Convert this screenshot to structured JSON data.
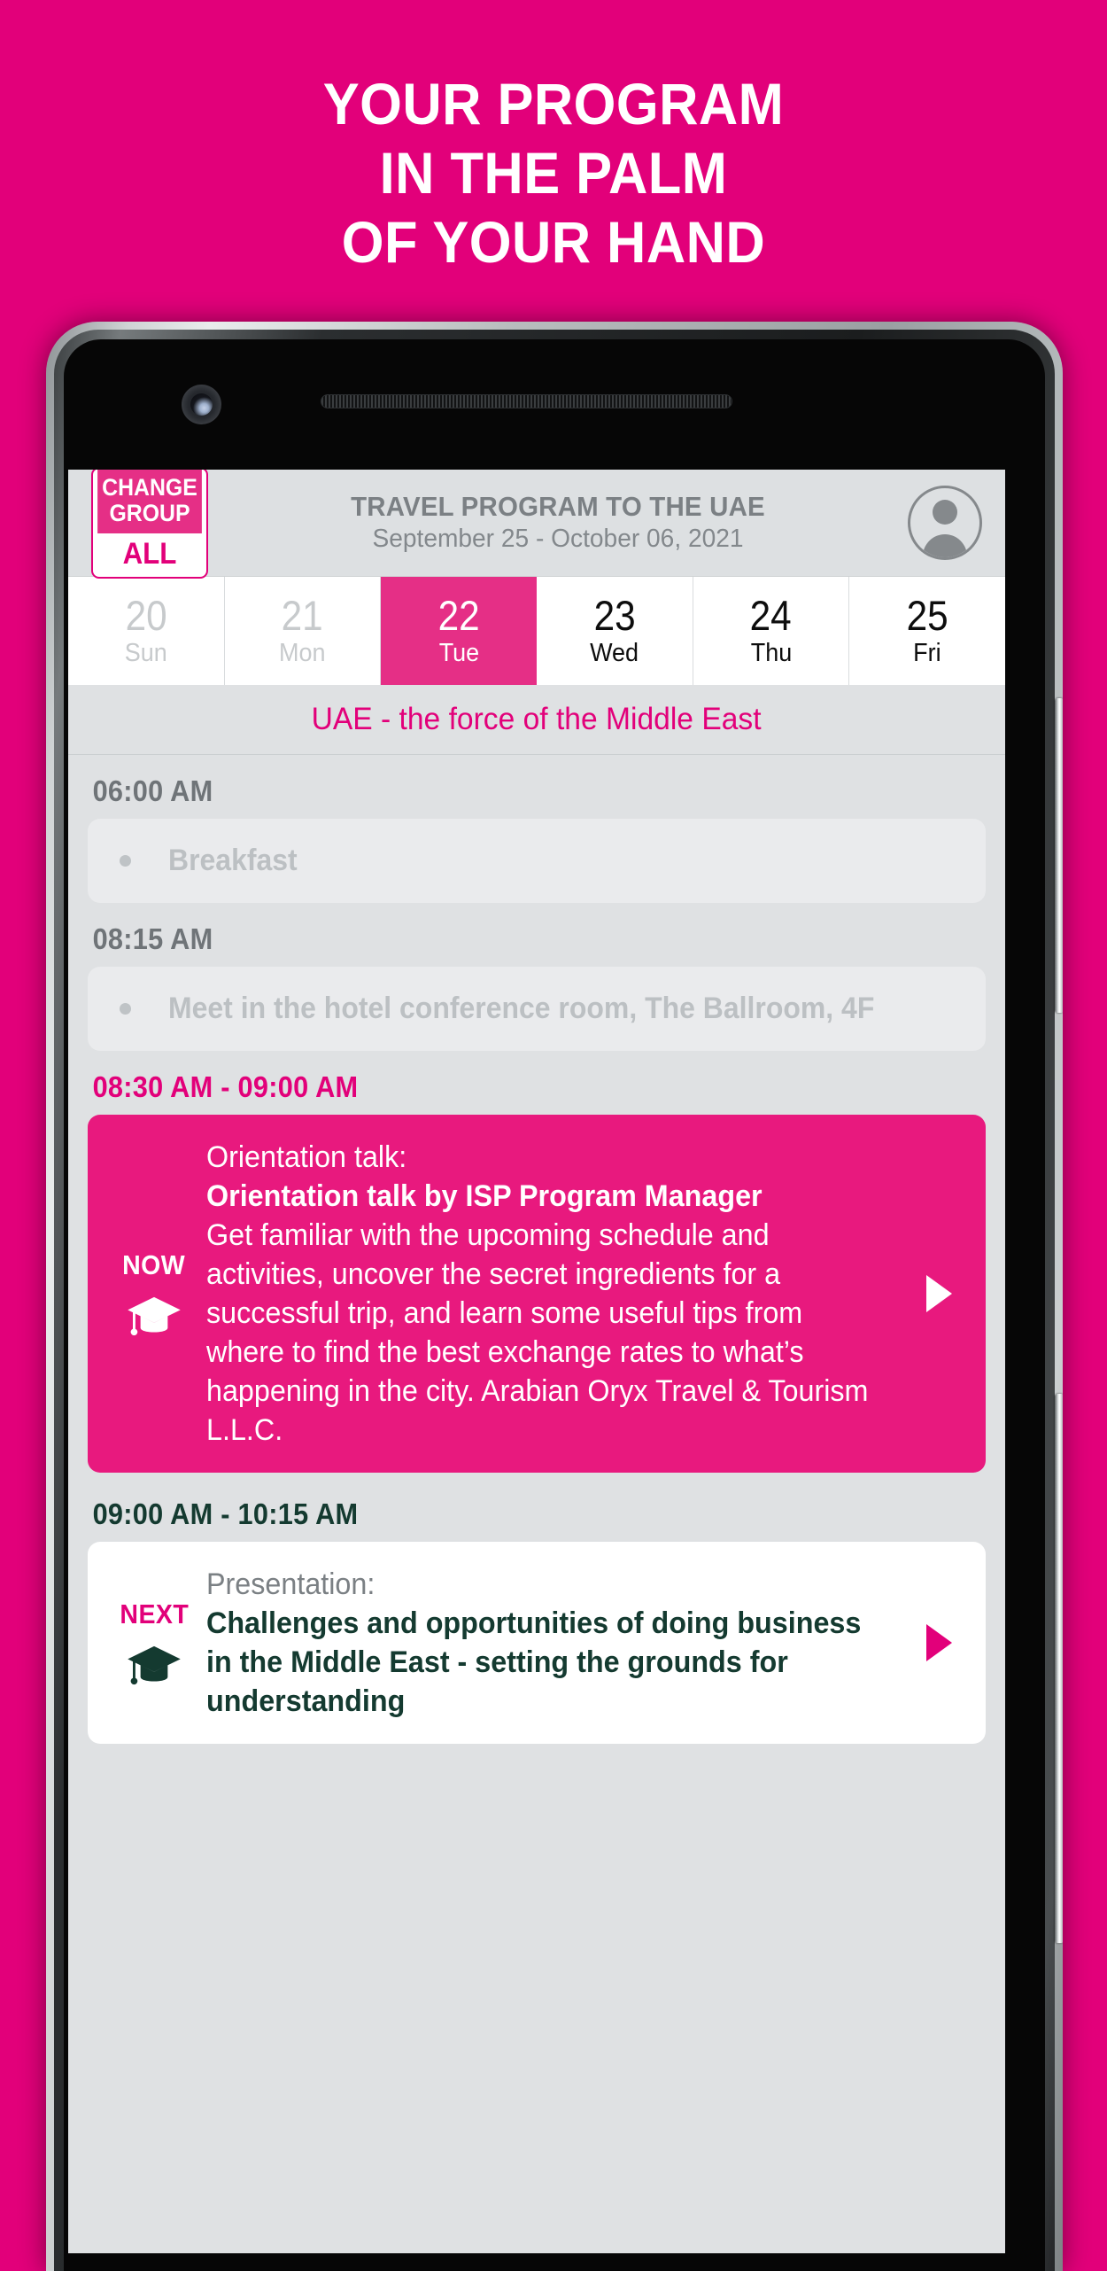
{
  "promo": {
    "headline_lines": [
      "YOUR PROGRAM",
      "IN THE PALM",
      "OF YOUR HAND"
    ],
    "background_color": "#e2007a"
  },
  "app": {
    "header": {
      "change_group_top_line1": "CHANGE",
      "change_group_top_line2": "GROUP",
      "change_group_value": "ALL",
      "title": "TRAVEL PROGRAM TO THE UAE",
      "subtitle": "September 25 - October 06, 2021",
      "avatar_icon": "person-icon"
    },
    "date_strip": [
      {
        "day": "20",
        "dow": "Sun",
        "state": "past"
      },
      {
        "day": "21",
        "dow": "Mon",
        "state": "past"
      },
      {
        "day": "22",
        "dow": "Tue",
        "state": "selected"
      },
      {
        "day": "23",
        "dow": "Wed",
        "state": "normal"
      },
      {
        "day": "24",
        "dow": "Thu",
        "state": "normal"
      },
      {
        "day": "25",
        "dow": "Fri",
        "state": "normal"
      }
    ],
    "day_subtitle": "UAE - the force of the Middle East",
    "schedule": [
      {
        "time": "06:00 AM",
        "time_style": "muted",
        "card_style": "faded",
        "title": "Breakfast"
      },
      {
        "time": "08:15 AM",
        "time_style": "muted",
        "card_style": "faded",
        "title": "Meet in the hotel conference room, The Ballroom, 4F"
      },
      {
        "time": "08:30 AM - 09:00 AM",
        "time_style": "active",
        "card_style": "now",
        "badge": "NOW",
        "icon": "graduation-cap-icon",
        "kicker": "Orientation talk:",
        "title": "Orientation talk by ISP Program Manager",
        "description": "Get familiar with the upcoming schedule and activities, uncover the secret ingredients for a successful trip, and learn some useful tips from where to find the best exchange rates to what’s happening in the city. Arabian Oryx Travel & Tourism L.L.C.",
        "arrow_icon": "play-arrow-icon"
      },
      {
        "time": "09:00 AM - 10:15 AM",
        "time_style": "next",
        "card_style": "next",
        "badge": "NEXT",
        "icon": "graduation-cap-icon",
        "kicker": "Presentation:",
        "title": "Challenges and opportunities of doing business in the Middle East - setting the grounds for understanding",
        "arrow_icon": "play-arrow-icon"
      }
    ]
  },
  "colors": {
    "brand_pink": "#e2007a",
    "card_pink": "#e8197e",
    "dark_green": "#143a30",
    "muted_grey": "#7b8084"
  }
}
